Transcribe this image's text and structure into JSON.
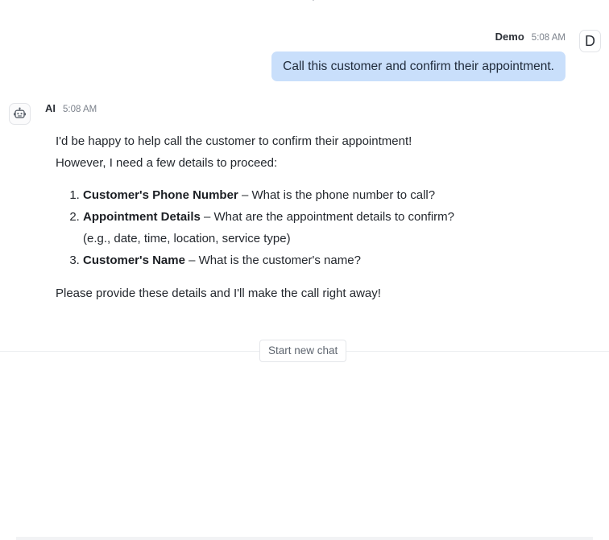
{
  "user_message": {
    "name": "Demo",
    "time": "5:08 AM",
    "avatar_letter": "D",
    "text": "Call this customer and confirm their appointment."
  },
  "ai_message": {
    "name": "AI",
    "time": "5:08 AM",
    "avatar_icon": "robot-icon",
    "intro_line1": "I'd be happy to help call the customer to confirm their appointment!",
    "intro_line2": "However, I need a few details to proceed:",
    "items": [
      {
        "title": "Customer's Phone Number",
        "text": " – What is the phone number to call?"
      },
      {
        "title": "Appointment Details",
        "text": " – What are the appointment details to confirm?",
        "text2": "(e.g., date, time, location, service type)"
      },
      {
        "title": "Customer's Name",
        "text": " – What is the customer's name?"
      }
    ],
    "closing": "Please provide these details and I'll make the call right away!"
  },
  "new_chat_label": "Start new chat",
  "colors": {
    "user_bubble": "#c9dffb",
    "divider": "#ebedf0"
  }
}
